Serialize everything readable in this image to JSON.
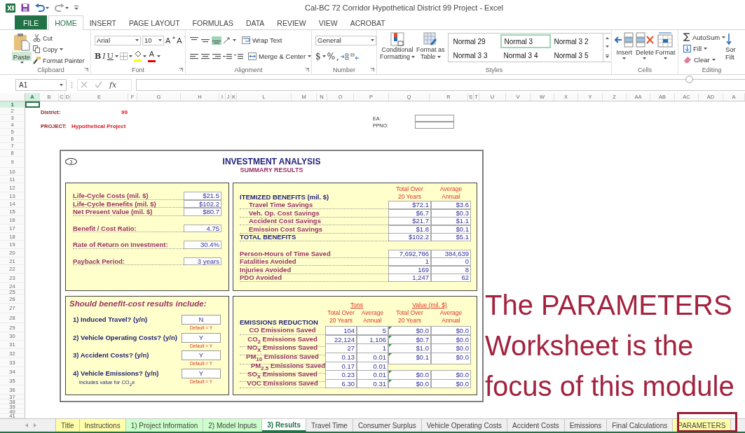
{
  "title_bar": {
    "title": "Cal-BC 72 Corridor Hypothetical District 99 Project - Excel"
  },
  "ribbon_tabs": [
    {
      "label": "FILE",
      "kind": "file",
      "selected": false
    },
    {
      "label": "HOME",
      "kind": "tab",
      "selected": true
    },
    {
      "label": "INSERT",
      "kind": "tab",
      "selected": false
    },
    {
      "label": "PAGE LAYOUT",
      "kind": "tab",
      "selected": false
    },
    {
      "label": "FORMULAS",
      "kind": "tab",
      "selected": false
    },
    {
      "label": "DATA",
      "kind": "tab",
      "selected": false
    },
    {
      "label": "REVIEW",
      "kind": "tab",
      "selected": false
    },
    {
      "label": "VIEW",
      "kind": "tab",
      "selected": false
    },
    {
      "label": "ACROBAT",
      "kind": "tab",
      "selected": false
    }
  ],
  "clipboard": {
    "label": "Clipboard",
    "paste": "Paste",
    "commands": [
      {
        "label": "Cut",
        "kind": "cut"
      },
      {
        "label": "Copy",
        "kind": "copy"
      },
      {
        "label": "Format Painter",
        "kind": "painter"
      }
    ]
  },
  "font": {
    "label": "Font",
    "family": "Arial",
    "size": "10",
    "grow_glyph": "A",
    "shrink_glyph": "A",
    "styles": [
      "B",
      "I",
      "U"
    ],
    "color_glyph": "A"
  },
  "alignment": {
    "label": "Alignment",
    "wrap": "Wrap Text",
    "merge": "Merge & Center"
  },
  "number": {
    "label": "Number",
    "format": "General",
    "symbols": [
      "$",
      "%",
      ","
    ]
  },
  "styles": {
    "label": "Styles",
    "conditional": [
      "Conditional",
      "Formatting"
    ],
    "table": [
      "Format as",
      "Table"
    ],
    "gallery": [
      {
        "label": "Normal 29",
        "selected": false
      },
      {
        "label": "Normal 3",
        "selected": true
      },
      {
        "label": "Normal 3 2",
        "selected": false
      },
      {
        "label": "Normal 3 3",
        "selected": false
      },
      {
        "label": "Normal 3 4",
        "selected": false
      },
      {
        "label": "Normal 3 5",
        "selected": false
      }
    ]
  },
  "cells": {
    "label": "Cells",
    "commands": [
      {
        "label": "Insert",
        "kind": "insert"
      },
      {
        "label": "Delete",
        "kind": "delete"
      },
      {
        "label": "Format",
        "kind": "format"
      }
    ]
  },
  "editing": {
    "label": "Editing",
    "commands": [
      {
        "label": "AutoSum",
        "kind": "sum"
      },
      {
        "label": "Fill",
        "kind": "fill"
      },
      {
        "label": "Clear",
        "kind": "clear"
      }
    ],
    "sort": [
      "Sor",
      "Filt"
    ]
  },
  "formula_bar": {
    "name_box": "A1",
    "fx": "fx"
  },
  "columns": [
    {
      "label": "A",
      "selected": true
    },
    {
      "label": "B",
      "selected": false
    },
    {
      "label": "C",
      "selected": false
    },
    {
      "label": "D",
      "selected": false
    },
    {
      "label": "E",
      "selected": false
    },
    {
      "label": "F",
      "selected": false
    },
    {
      "label": "G",
      "selected": false
    },
    {
      "label": "H",
      "selected": false
    },
    {
      "label": "I",
      "selected": false
    },
    {
      "label": "J",
      "selected": false
    },
    {
      "label": "K",
      "selected": false
    },
    {
      "label": "L",
      "selected": false
    },
    {
      "label": "M",
      "selected": false
    },
    {
      "label": "N",
      "selected": false
    },
    {
      "label": "O",
      "selected": false
    },
    {
      "label": "P",
      "selected": false
    },
    {
      "label": "Q",
      "selected": false
    },
    {
      "label": "R",
      "selected": false
    },
    {
      "label": "S",
      "selected": false
    },
    {
      "label": "T",
      "selected": false
    },
    {
      "label": "U",
      "selected": false
    },
    {
      "label": "V",
      "selected": false
    },
    {
      "label": "W",
      "selected": false
    },
    {
      "label": "X",
      "selected": false
    },
    {
      "label": "Y",
      "selected": false
    },
    {
      "label": "Z",
      "selected": false
    },
    {
      "label": "AA",
      "selected": false
    },
    {
      "label": "AB",
      "selected": false
    },
    {
      "label": "AC",
      "selected": false
    },
    {
      "label": "AD",
      "selected": false
    },
    {
      "label": "A",
      "selected": false
    }
  ],
  "rows": [
    {
      "label": "1",
      "selected": true
    },
    {
      "label": "2",
      "selected": false
    },
    {
      "label": "3",
      "selected": false
    },
    {
      "label": "4",
      "selected": false
    },
    {
      "label": "5",
      "selected": false
    },
    {
      "label": "6",
      "selected": false
    },
    {
      "label": "7",
      "selected": false
    },
    {
      "label": "8",
      "selected": false
    },
    {
      "label": "9",
      "selected": false
    },
    {
      "label": "10",
      "selected": false
    },
    {
      "label": "11",
      "selected": false
    },
    {
      "label": "12",
      "selected": false
    },
    {
      "label": "13",
      "selected": false
    },
    {
      "label": "14",
      "selected": false
    },
    {
      "label": "15",
      "selected": false
    },
    {
      "label": "16",
      "selected": false
    },
    {
      "label": "17",
      "selected": false
    },
    {
      "label": "18",
      "selected": false
    },
    {
      "label": "19",
      "selected": false
    },
    {
      "label": "20",
      "selected": false
    },
    {
      "label": "21",
      "selected": false
    },
    {
      "label": "22",
      "selected": false
    },
    {
      "label": "23",
      "selected": false
    },
    {
      "label": "24",
      "selected": false
    },
    {
      "label": "25",
      "selected": false
    },
    {
      "label": "26",
      "selected": false
    },
    {
      "label": "27",
      "selected": false
    },
    {
      "label": "28",
      "selected": false
    },
    {
      "label": "29",
      "selected": false
    },
    {
      "label": "30",
      "selected": false
    },
    {
      "label": "31",
      "selected": false
    },
    {
      "label": "32",
      "selected": false
    },
    {
      "label": "33",
      "selected": false
    },
    {
      "label": "34",
      "selected": false
    },
    {
      "label": "35",
      "selected": false
    },
    {
      "label": "36",
      "selected": false
    },
    {
      "label": "37",
      "selected": false
    },
    {
      "label": "38",
      "selected": false
    },
    {
      "label": "39",
      "selected": false
    },
    {
      "label": "40",
      "selected": false
    },
    {
      "label": "41",
      "selected": false
    }
  ],
  "sheet": {
    "district_label": "District:",
    "district": "99",
    "project_label": "PROJECT:",
    "project": "Hypothetical Project",
    "ea_label": "EA:",
    "ppno_label": "PPNO:"
  },
  "analysis": {
    "badge": "3",
    "title": "INVESTMENT ANALYSIS",
    "subtitle": "SUMMARY RESULTS",
    "summary": [
      {
        "items": [
          {
            "label": "Life-Cycle Costs (mil. $)",
            "value": "$21.5"
          },
          {
            "label": "Life-Cycle Benefits (mil. $)",
            "value": "$102.2"
          },
          {
            "label": "Net Present Value (mil. $)",
            "value": "$80.7"
          }
        ]
      },
      {
        "items": [
          {
            "label": "Benefit / Cost Ratio:",
            "value": "4.75"
          }
        ]
      },
      {
        "items": [
          {
            "label": "Rate of Return on Investment:",
            "value": "30.4%"
          }
        ]
      },
      {
        "items": [
          {
            "label": "Payback Period:",
            "value": "3 years"
          }
        ]
      }
    ],
    "benefits": {
      "heading": "ITEMIZED BENEFITS (mil. $)",
      "columns": [
        [
          "Total Over",
          "20 Years"
        ],
        [
          "Average",
          "Annual"
        ]
      ],
      "rows": [
        {
          "label": "Travel Time Savings",
          "kind": "item",
          "total": "$72.1",
          "annual": "$3.6"
        },
        {
          "label": "Veh. Op. Cost Savings",
          "kind": "item",
          "total": "$6.7",
          "annual": "$0.3"
        },
        {
          "label": "Accident Cost Savings",
          "kind": "item",
          "total": "$21.7",
          "annual": "$1.1"
        },
        {
          "label": "Emission Cost Savings",
          "kind": "item",
          "total": "$1.8",
          "annual": "$0.1"
        },
        {
          "label": "TOTAL BENEFITS",
          "kind": "total",
          "total": "$102.2",
          "annual": "$5.1"
        }
      ],
      "outcomes": [
        {
          "label": "Person-Hours of Time Saved",
          "total": "7,692,786",
          "annual": "384,639"
        },
        {
          "label": "Fatalities Avoided",
          "total": "1",
          "annual": "0"
        },
        {
          "label": "Injuries Avoided",
          "total": "169",
          "annual": "8"
        },
        {
          "label": "PDO Avoided",
          "total": "1,247",
          "annual": "62"
        }
      ]
    },
    "questions": {
      "heading": "Should benefit-cost results include:",
      "items": [
        {
          "label": "1) Induced Travel? (y/n)",
          "value": "N",
          "default": "Default = Y"
        },
        {
          "label": "2) Vehicle Operating Costs? (y/n)",
          "value": "Y",
          "default": "Default = Y"
        },
        {
          "label": "3) Accident Costs? (y/n)",
          "value": "Y",
          "default": "Default = Y"
        },
        {
          "label": "4) Vehicle Emissions? (y/n)",
          "value": "Y",
          "default": "Default = Y",
          "note": "includes value for CO$_{2}$e"
        }
      ]
    },
    "emissions": {
      "heading": "EMISSIONS REDUCTION",
      "groups": [
        "Tons",
        "Value (mil. $)"
      ],
      "columns": [
        [
          "Total Over",
          "20 Years"
        ],
        [
          "Average",
          "Annual"
        ],
        [
          "Total Over",
          "20 Years"
        ],
        [
          "Average",
          "Annual"
        ]
      ],
      "rows": [
        {
          "label": "CO Emissions Saved",
          "kind": "full",
          "flagged": true,
          "values": [
            "104",
            "5",
            "$0.0",
            "$0.0"
          ]
        },
        {
          "label": "CO$_{2}$ Emissions Saved",
          "kind": "full",
          "flagged": true,
          "values": [
            "22,124",
            "1,106",
            "$0.7",
            "$0.0"
          ]
        },
        {
          "label": "NO$_{X}$ Emissions Saved",
          "kind": "full",
          "flagged": true,
          "values": [
            "27",
            "1",
            "$1.0",
            "$0.0"
          ]
        },
        {
          "label": "PM$_{10}$ Emissions Saved",
          "kind": "full",
          "flagged": true,
          "values": [
            "0.13",
            "0.01",
            "$0.1",
            "$0.0"
          ]
        },
        {
          "label": "PM$_{2.5}$ Emissions Saved",
          "kind": "sub",
          "flagged": false,
          "values": [
            "0.17",
            "0.01"
          ]
        },
        {
          "label": "SO$_{X}$ Emissions Saved",
          "kind": "full",
          "flagged": true,
          "values": [
            "0.23",
            "0.01",
            "$0.0",
            "$0.0"
          ]
        },
        {
          "label": "VOC Emissions Saved",
          "kind": "full",
          "flagged": true,
          "values": [
            "6.30",
            "0.31",
            "$0.0",
            "$0.0"
          ]
        }
      ]
    }
  },
  "sheet_tabs": [
    {
      "label": "Title",
      "color": "#ffffaa",
      "selected": false
    },
    {
      "label": "Instructions",
      "color": "#ffffaa",
      "selected": false
    },
    {
      "label": "1) Project Information",
      "color": "#ccffcc",
      "selected": false
    },
    {
      "label": "2) Model Inputs",
      "color": "#ccffcc",
      "selected": false
    },
    {
      "label": "3) Results",
      "selected": true
    },
    {
      "label": "Travel Time",
      "selected": false
    },
    {
      "label": "Consumer Surplus",
      "selected": false
    },
    {
      "label": "Vehicle Operating Costs",
      "selected": false
    },
    {
      "label": "Accident Costs",
      "selected": false
    },
    {
      "label": "Emissions",
      "selected": false
    },
    {
      "label": "Final Calculations",
      "selected": false
    },
    {
      "label": "PARAMETERS",
      "color": "#ffffaa",
      "selected": false
    }
  ],
  "annotation": {
    "lines": [
      "The PARAMETERS",
      "Worksheet is the",
      "focus of this module"
    ]
  }
}
